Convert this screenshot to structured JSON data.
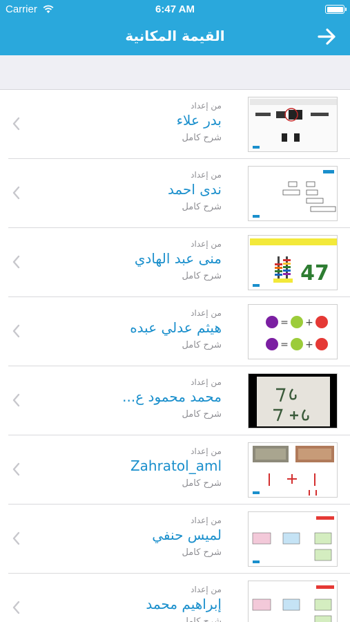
{
  "status_bar": {
    "carrier": "Carrier",
    "time": "6:47 AM"
  },
  "nav": {
    "title": "القيمة المكانية",
    "forward_icon": "arrow-right-icon"
  },
  "colors": {
    "bar": "#2aa8dc",
    "author": "#1a8fcc",
    "secondary": "#8e8e93"
  },
  "lessons": [
    {
      "prep_label": "من إعداد",
      "author": "بدر علاء",
      "description": "شرح كامل",
      "thumb": "thumb-place-value-circle"
    },
    {
      "prep_label": "من إعداد",
      "author": "ندى احمد",
      "description": "شرح كامل",
      "thumb": "thumb-expanded-form-boxes"
    },
    {
      "prep_label": "من إعداد",
      "author": "منى عبد الهادي",
      "description": "شرح كامل",
      "thumb": "thumb-abacus-47"
    },
    {
      "prep_label": "من إعداد",
      "author": "هيثم عدلي عبده",
      "description": "شرح كامل",
      "thumb": "thumb-colored-balls"
    },
    {
      "prep_label": "من إعداد",
      "author": "محمد محمود ع...",
      "description": "شرح كامل",
      "thumb": "thumb-chalkboard-76"
    },
    {
      "prep_label": "من إعداد",
      "author": "Zahratol_aml",
      "description": "شرح كامل",
      "thumb": "thumb-banknotes"
    },
    {
      "prep_label": "من إعداد",
      "author": "لميس حنفي",
      "description": "شرح كامل",
      "thumb": "thumb-place-value-cards"
    },
    {
      "prep_label": "من إعداد",
      "author": "إبراهيم محمد",
      "description": "شرح كامل",
      "thumb": "thumb-place-value-cards-2"
    }
  ]
}
